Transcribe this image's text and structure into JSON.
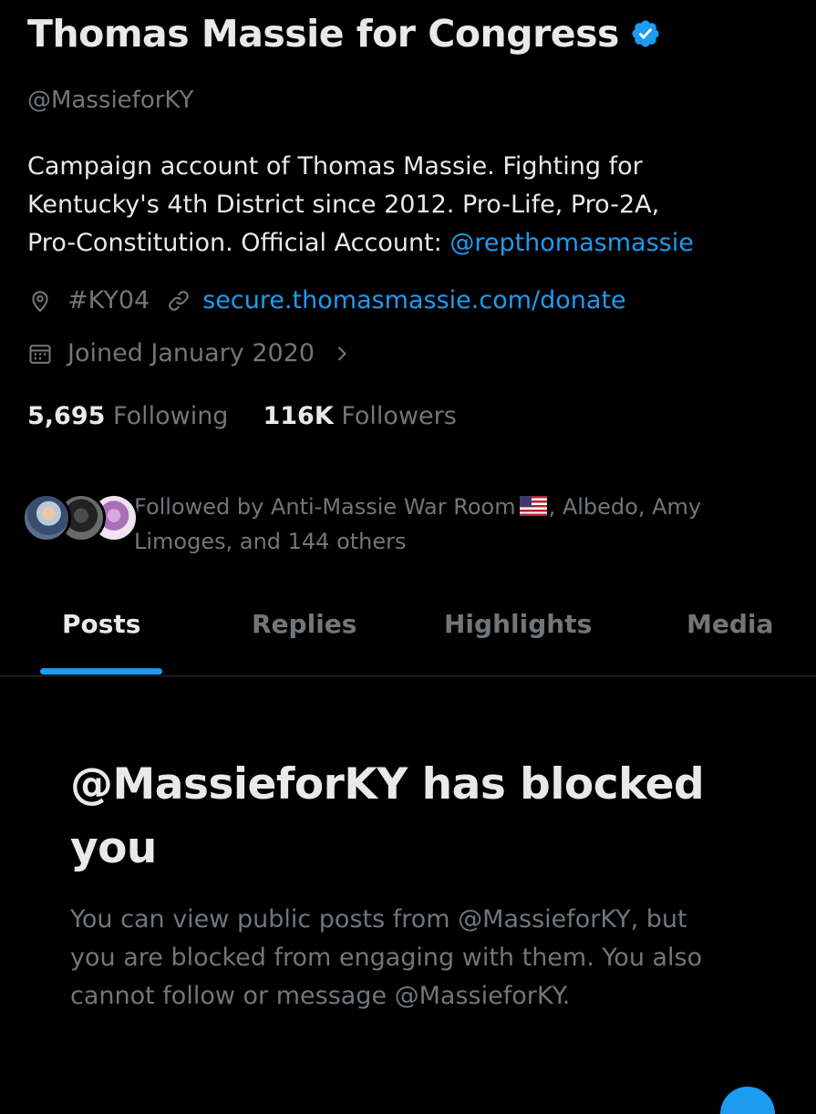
{
  "profile": {
    "display_name": "Thomas Massie for Congress",
    "handle": "@MassieforKY",
    "bio": {
      "line1": "Campaign account of Thomas Massie. Fighting for",
      "line2": "Kentucky's 4th District since 2012. Pro-Life, Pro-2A,",
      "line3_prefix": "Pro-Constitution. Official Account: ",
      "line3_link": "@repthomasmassie"
    },
    "location": "#KY04",
    "website": "secure.thomasmassie.com/donate",
    "joined": "Joined January 2020",
    "following_count": "5,695",
    "following_label": "Following",
    "followers_count": "116K",
    "followers_label": "Followers",
    "followed_by": {
      "line1_a": "Followed by Anti-Massie War Room",
      "line1_b": ", Albedo, Amy",
      "line2": "Limoges, and 144 others"
    }
  },
  "tabs": [
    {
      "label": "Posts",
      "active": true
    },
    {
      "label": "Replies",
      "active": false
    },
    {
      "label": "Highlights",
      "active": false
    },
    {
      "label": "Media",
      "active": false
    }
  ],
  "blocked": {
    "title_line1": "@MassieforKY has blocked",
    "title_line2": "you",
    "desc_line1": "You can view public posts from @MassieforKY, but",
    "desc_line2": "you are blocked from engaging with them. You also",
    "desc_line3": "cannot follow or message @MassieforKY."
  },
  "icons": {
    "verified": "verified-badge-icon",
    "location": "location-pin-icon",
    "website": "link-icon",
    "joined": "calendar-icon",
    "joined_more": "chevron-right-icon",
    "flag": "us-flag-icon"
  },
  "colors": {
    "background": "#000000",
    "text_primary": "#e7e9ea",
    "text_secondary": "#71767b",
    "accent": "#1d9bf0",
    "divider": "#2f3336"
  }
}
